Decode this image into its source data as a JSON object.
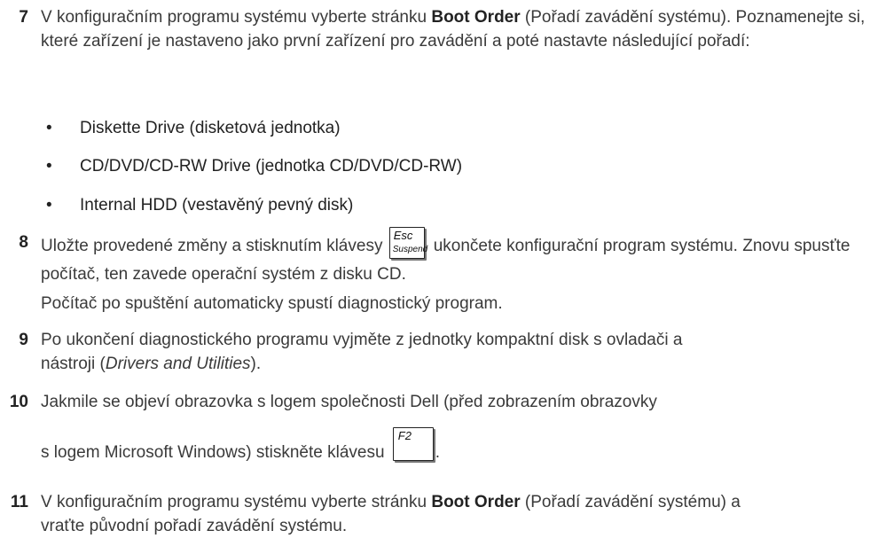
{
  "step7": {
    "number": "7",
    "before": "V konfiguračním programu systému vyberte stránku ",
    "bold": "Boot Order",
    "after": " (Pořadí zavádění systému). Poznamenejte si, které zařízení je nastaveno jako první zařízení pro zavádění a poté nastavte následující pořadí:"
  },
  "bullets": [
    "Diskette Drive (disketová jednotka)",
    "CD/DVD/CD-RW Drive (jednotka CD/DVD/CD-RW)",
    "Internal HDD (vestavěný pevný disk)"
  ],
  "bullet_symbol": "•",
  "step8": {
    "number": "8",
    "before": "Uložte provedené změny a stisknutím klávesy",
    "after": "ukončete konfigurační program systému. Znovu spusťte počítač, ten zavede operační systém z disku CD.",
    "note": "Počítač po spuštění automaticky spustí diagnostický program."
  },
  "esc_key": {
    "top": "Esc",
    "bottom": "Suspend"
  },
  "step9": {
    "number": "9",
    "before": "Po ukončení diagnostického programu vyjměte z jednotky kompaktní disk s ovladači a nástroji (",
    "italic": "Drivers and Utilities",
    "after": ")."
  },
  "step10": {
    "number": "10",
    "line1": "Jakmile se objeví obrazovka s logem společnosti Dell (před zobrazením obrazovky",
    "line2": "s logem Microsoft Windows) stiskněte klávesu",
    "after": "."
  },
  "f2_key": {
    "label": "F2"
  },
  "step11": {
    "number": "11",
    "before": "V konfiguračním programu systému vyberte stránku ",
    "bold": "Boot Order",
    "after": " (Pořadí zavádění systému) a vraťte původní pořadí zavádění systému."
  }
}
